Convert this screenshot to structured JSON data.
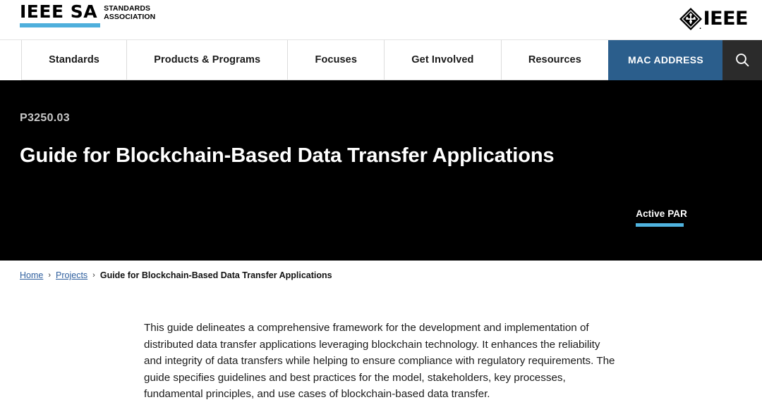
{
  "header": {
    "logo_primary": "IEEE SA",
    "logo_secondary_line1": "STANDARDS",
    "logo_secondary_line2": "ASSOCIATION",
    "brand_wordmark": "IEEE",
    "accent_color": "#4fafdc"
  },
  "nav": {
    "items": [
      {
        "label": "Standards"
      },
      {
        "label": "Products & Programs"
      },
      {
        "label": "Focuses"
      },
      {
        "label": "Get Involved"
      },
      {
        "label": "Resources"
      }
    ],
    "mac_address_label": "MAC ADDRESS",
    "mac_address_color": "#2b5e8c",
    "search_bg_color": "#2b2b2b"
  },
  "hero": {
    "designation": "P3250.03",
    "title": "Guide for Blockchain-Based Data Transfer Applications",
    "status_badge": "Active PAR",
    "status_accent_color": "#4fb3df",
    "background_color": "#000000"
  },
  "breadcrumb": {
    "home": "Home",
    "projects": "Projects",
    "separator": "›",
    "current": "Guide for Blockchain-Based Data Transfer Applications"
  },
  "main": {
    "description": "This guide delineates a comprehensive framework for the development and implementation of distributed data transfer applications leveraging blockchain technology. It enhances the reliability and integrity of data transfers while helping to ensure compliance with regulatory requirements. The guide specifies guidelines and best practices for the model, stakeholders, key processes, fundamental principles, and use cases of blockchain-based data transfer."
  }
}
